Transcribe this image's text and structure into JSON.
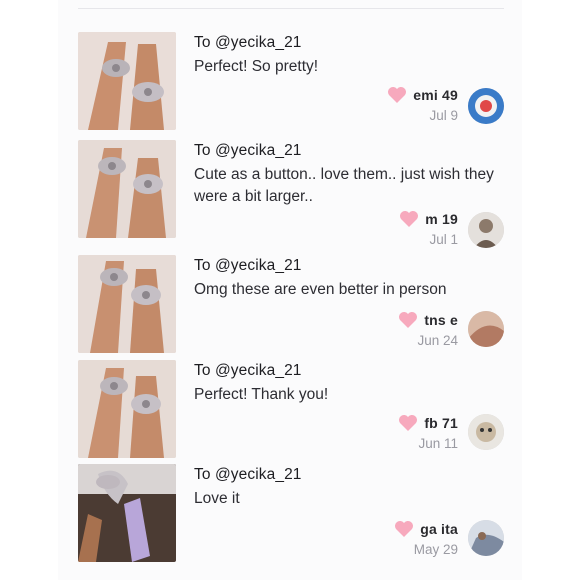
{
  "reviews": [
    {
      "to": "To @yecika_21",
      "message": "Perfect! So pretty!",
      "username": "emi      49",
      "date": "Jul 9",
      "avatar_color": "#3a7bc8"
    },
    {
      "to": "To @yecika_21",
      "message": "Cute as a button.. love them.. just wish they were a bit larger..",
      "username": "m         19",
      "date": "Jul 1",
      "avatar_color": "#8c7a6b"
    },
    {
      "to": "To @yecika_21",
      "message": "Omg these are even better in person",
      "username": "tns      e",
      "date": "Jun 24",
      "avatar_color": "#b27a63"
    },
    {
      "to": "To @yecika_21",
      "message": "Perfect! Thank you!",
      "username": "fb       71",
      "date": "Jun 11",
      "avatar_color": "#c9b9a2"
    },
    {
      "to": "To @yecika_21",
      "message": "Love it",
      "username": "ga        ita",
      "date": "May 29",
      "avatar_color": "#7d8aa0"
    }
  ],
  "icons": {
    "like": "heart-icon"
  },
  "colors": {
    "heart": "#f7a9bd",
    "date": "#9a9aa2"
  }
}
